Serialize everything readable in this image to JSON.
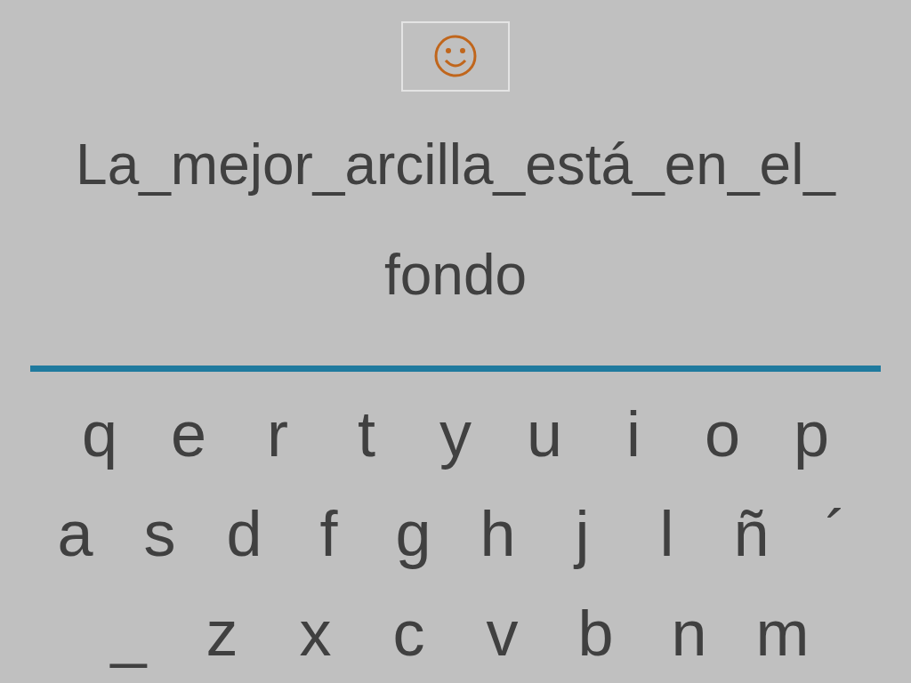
{
  "phrase_lines": [
    "La_mejor_arcilla_está_en_el_",
    "fondo"
  ],
  "keyboard_rows": [
    [
      "q",
      "e",
      "r",
      "t",
      "y",
      "u",
      "i",
      "o",
      "p"
    ],
    [
      "a",
      "s",
      "d",
      "f",
      "g",
      "h",
      "j",
      "l",
      "ñ",
      "´"
    ],
    [
      "_",
      "z",
      "x",
      "c",
      "v",
      "b",
      "n",
      "m"
    ]
  ]
}
